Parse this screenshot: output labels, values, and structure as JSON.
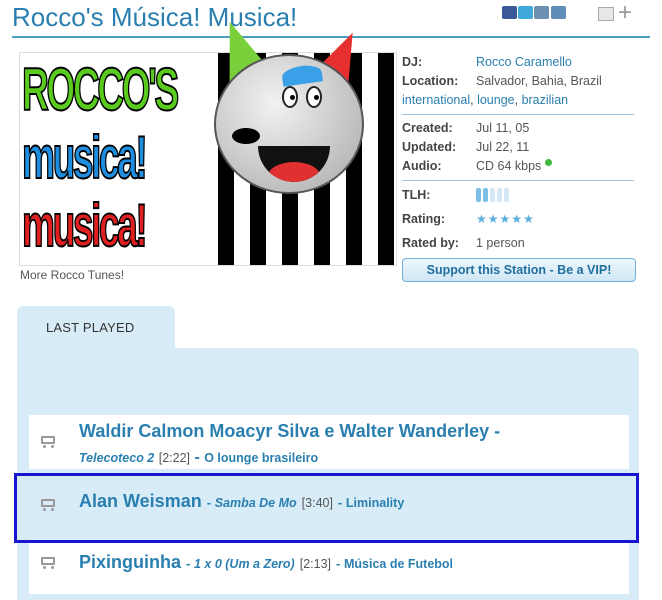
{
  "header": {
    "title": "Rocco's Música! Musica!",
    "share_icons": [
      "facebook-icon",
      "twitter-icon",
      "email-icon",
      "gear-icon"
    ],
    "minimize_icon": "minimize-icon",
    "expand_icon": "plus-icon"
  },
  "artwork": {
    "line1": "ROCCO'S",
    "line2": "musica!",
    "line3": "musica!",
    "caption": "More Rocco Tunes!"
  },
  "station": {
    "dj_label": "DJ:",
    "dj_value": "Rocco Caramello",
    "location_label": "Location:",
    "location_value": "Salvador, Bahia, Brazil",
    "tags": [
      "international",
      "lounge",
      "brazilian"
    ],
    "created_label": "Created:",
    "created_value": "Jul 11, 05",
    "updated_label": "Updated:",
    "updated_value": "Jul 22, 11",
    "audio_label": "Audio:",
    "audio_value": "CD 64 kbps",
    "tlh_label": "TLH:",
    "tlh_level": 0.4,
    "rating_label": "Rating:",
    "rating_stars": 5,
    "rated_by_label": "Rated by:",
    "rated_by_value": "1 person",
    "vip_button": "Support this Station - Be a VIP!"
  },
  "last_played": {
    "tab_label": "LAST PLAYED",
    "tracks": [
      {
        "artist": "Waldir Calmon Moacyr Silva e Walter Wanderley",
        "song": "Telecoteco 2",
        "duration": "[2:22]",
        "album": "O lounge brasileiro"
      },
      {
        "artist": "Alan Weisman",
        "song": "Samba De Mo",
        "duration": "[3:40]",
        "album": "Liminality"
      },
      {
        "artist": "Pixinguinha",
        "song": "1 x 0 (Um a Zero)",
        "duration": "[2:13]",
        "album": "Música de Futebol"
      }
    ]
  },
  "colors": {
    "accent": "#2a7fb0",
    "panel_bg": "#d8ecf7",
    "selection_border": "#1616d0"
  }
}
